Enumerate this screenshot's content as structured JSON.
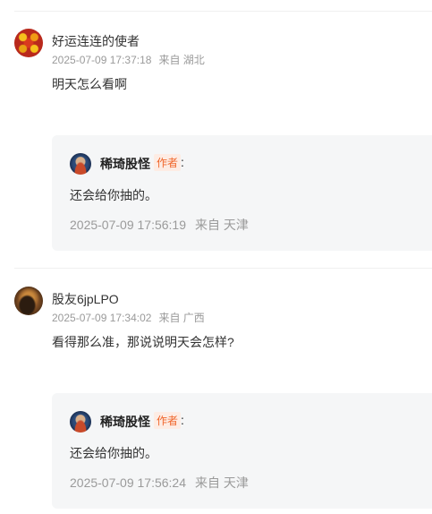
{
  "comments": [
    {
      "avatar_icon": "flower-avatar",
      "username": "好运连连的使者",
      "time": "2025-07-09 17:37:18",
      "location": "来自 湖北",
      "text": "明天怎么看啊",
      "reply": {
        "avatar_icon": "author-avatar",
        "username": "稀琦股怪",
        "tag": "作者",
        "colon": ":",
        "text": "还会给你抽的。",
        "time": "2025-07-09 17:56:19",
        "location": "来自 天津"
      }
    },
    {
      "avatar_icon": "brown-avatar",
      "username": "股友6jpLPO",
      "time": "2025-07-09 17:34:02",
      "location": "来自 广西",
      "text": "看得那么准，那说说明天会怎样?",
      "reply": {
        "avatar_icon": "author-avatar",
        "username": "稀琦股怪",
        "tag": "作者",
        "colon": ":",
        "text": "还会给你抽的。",
        "time": "2025-07-09 17:56:24",
        "location": "来自 天津"
      }
    }
  ],
  "colors": {
    "author_tag_text": "#f0662b",
    "author_tag_bg": "#fdece4",
    "reply_bg": "#f5f6f7",
    "meta_text": "#9a9a9a"
  }
}
